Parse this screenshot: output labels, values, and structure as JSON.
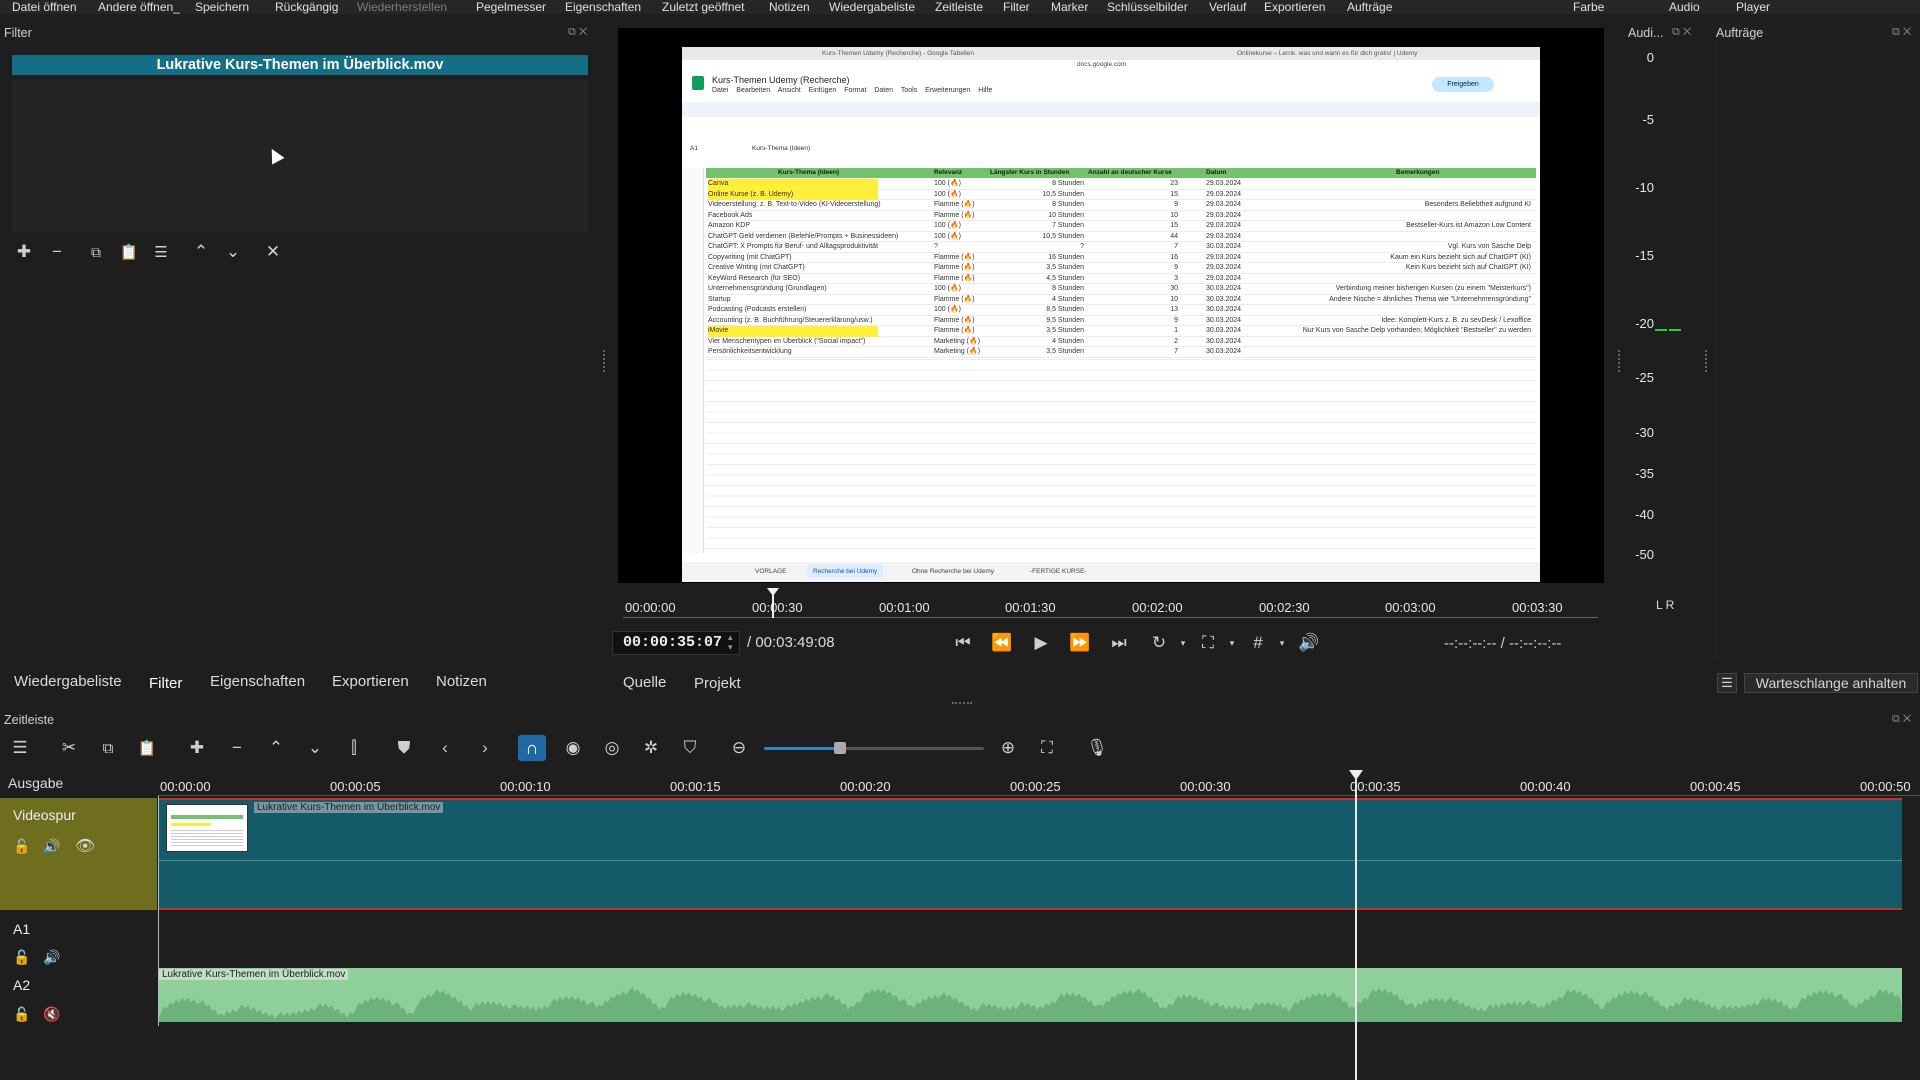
{
  "menubar": {
    "items": [
      "Datei öffnen",
      "Andere öffnen_",
      "Speichern",
      "Rückgängig",
      "Wiederherstellen",
      "Pegelmesser",
      "Eigenschaften",
      "Zuletzt geöffnet",
      "Notizen",
      "Wiedergabeliste",
      "Zeitleiste",
      "Filter",
      "Marker",
      "Schlüsselbilder",
      "Verlauf",
      "Exportieren",
      "Aufträge"
    ],
    "right_items": [
      "Farbe",
      "Audio",
      "Player"
    ]
  },
  "filter_panel": {
    "title": "Filter",
    "clip_name": "Lukrative Kurs-Themen im Überblick.mov"
  },
  "left_tabs": [
    "Wiedergabeliste",
    "Filter",
    "Eigenschaften",
    "Exportieren",
    "Notizen"
  ],
  "player": {
    "timecode": "00:00:35:07",
    "duration": "/ 00:03:49:08",
    "in_out": "--:--:--:-- / --:--:--:--",
    "ruler": [
      "00:00:00",
      "00:00:30",
      "00:01:00",
      "00:01:30",
      "00:02:00",
      "00:02:30",
      "00:03:00",
      "00:03:30"
    ],
    "tabs": [
      "Quelle",
      "Projekt"
    ]
  },
  "audio_panel": {
    "title": "Audi...",
    "scale": [
      "0",
      "-5",
      "-10",
      "-15",
      "-20",
      "-25",
      "-30",
      "-35",
      "-40",
      "-50"
    ],
    "channels": "L R",
    "accent": "#2ecc40"
  },
  "jobs_panel": {
    "title": "Aufträge",
    "pause_queue": "Warteschlange anhalten"
  },
  "timeline": {
    "title": "Zeitleiste",
    "output_label": "Ausgabe",
    "ruler": [
      "00:00:00",
      "00:00:05",
      "00:00:10",
      "00:00:15",
      "00:00:20",
      "00:00:25",
      "00:00:30",
      "00:00:35",
      "00:00:40",
      "00:00:45",
      "00:00:50"
    ],
    "tracks": [
      {
        "name": "Videospur",
        "clip": "Lukrative Kurs-Themen im Überblick.mov"
      },
      {
        "name": "A1",
        "clip": ""
      },
      {
        "name": "A2",
        "clip": "Lukrative Kurs-Themen im Überblick.mov"
      }
    ],
    "colors": {
      "video_clip": "#145a68",
      "audio_clip": "#8fd09a",
      "track_header": "#6e6e1e"
    }
  },
  "sheet": {
    "tab_title_1": "Kurs-Themen Udemy (Recherche) - Google Tabellen",
    "tab_title_2": "Onlinekurse – Lernk. was und wann es für dich gratis! | Udemy",
    "url": "docs.google.com",
    "doc_title": "Kurs-Themen Udemy (Recherche)",
    "menus": [
      "Datei",
      "Bearbeiten",
      "Ansicht",
      "Einfügen",
      "Format",
      "Daten",
      "Tools",
      "Erweiterungen",
      "Hilfe"
    ],
    "share": "Freigeben",
    "cell_ref": "A1",
    "formula": "Kurs-Thema (Ideen)",
    "headers": [
      "Kurs-Thema (Ideen)",
      "Relevanz",
      "Längster Kurs in Stunden",
      "Anzahl an deutscher Kurse",
      "Datum",
      "",
      "Bemerkungen"
    ],
    "rows": [
      [
        "Canva",
        "100 (🔥)",
        "8 Stunden",
        "23",
        "29.03.2024",
        "",
        ""
      ],
      [
        "Online Kurse (z. B. Udemy)",
        "100 (🔥)",
        "10,5 Stunden",
        "15",
        "29.03.2024",
        "",
        ""
      ],
      [
        "Videoerstellung: z. B. Text-to-Video (KI-Videoerstellung)",
        "Flamme (🔥)",
        "8 Stunden",
        "9",
        "29.03.2024",
        "",
        "Besonders Beliebtheit aufgrund KI"
      ],
      [
        "Facebook Ads",
        "Flamme (🔥)",
        "10 Stunden",
        "10",
        "29.03.2024",
        "",
        ""
      ],
      [
        "Amazon KDP",
        "100 (🔥)",
        "7 Stunden",
        "15",
        "29.03.2024",
        "",
        "Bestseller-Kurs ist Amazon Low Content"
      ],
      [
        "ChatGPT Geld verdienen (Befehle/Prompts + Businessideen)",
        "100 (🔥)",
        "10,5 Stunden",
        "44",
        "29.03.2024",
        "",
        ""
      ],
      [
        "ChatGPT: X Prompts für Beruf- und Alltagsproduktivität",
        "?",
        "?",
        "7",
        "30.03.2024",
        "",
        "Vgl. Kurs von Sasche Delp"
      ],
      [
        "Copywriting (mit ChatGPT)",
        "Flamme (🔥)",
        "16 Stunden",
        "16",
        "29.03.2024",
        "",
        "Kaum ein Kurs bezieht sich auf ChatGPT (KI)"
      ],
      [
        "Creative Writing (mit ChatGPT)",
        "Flamme (🔥)",
        "3,5 Stunden",
        "9",
        "29.03.2024",
        "",
        "Kein Kurs bezieht sich auf ChatGPT (KI)"
      ],
      [
        "KeyWord Research (für SEO)",
        "Flamme (🔥)",
        "4,5 Stunden",
        "3",
        "29.03.2024",
        "",
        ""
      ],
      [
        "Unternehmensgründung (Grundlagen)",
        "100 (🔥)",
        "8 Stunden",
        "30",
        "30.03.2024",
        "",
        "Verbindung meiner bisherigen Kursen (zu einem \"Meisterkurs\")"
      ],
      [
        "Startup",
        "Flamme (🔥)",
        "4 Stunden",
        "10",
        "30.03.2024",
        "",
        "Andere Nische = ähnliches Thema wie \"Unternehmensgründung\""
      ],
      [
        "Podcasting (Podcasts erstellen)",
        "100 (🔥)",
        "8,5 Stunden",
        "13",
        "30.03.2024",
        "",
        ""
      ],
      [
        "Accounting (z. B. Buchführung/Steuererklärung/usw.)",
        "Flamme (🔥)",
        "9,5 Stunden",
        "9",
        "30.03.2024",
        "",
        "Idee: Komplett-Kurs z. B. zu sevDesk / Lexoffice"
      ],
      [
        "iMovie",
        "Flamme (🔥)",
        "3,5 Stunden",
        "1",
        "30.03.2024",
        "",
        "Nur Kurs von Sasche Delp vorhanden; Möglichkeit \"Bestseller\" zu werden"
      ],
      [
        "Vier Menschentypen im Überblick (\"Social impact\")",
        "Marketing (🔥)",
        "4 Stunden",
        "2",
        "30.03.2024",
        "",
        ""
      ],
      [
        "Persönlichkeitsentwicklung",
        "Marketing (🔥)",
        "3,5 Stunden",
        "7",
        "30.03.2024",
        "",
        ""
      ]
    ],
    "sheet_tabs": [
      "VORLAGE",
      "Recherche bei Udemy",
      "Ohne Recherche bei Udemy",
      "-FERTIGE KURSE-"
    ]
  }
}
